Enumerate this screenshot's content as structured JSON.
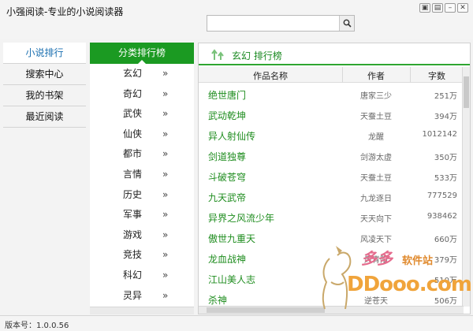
{
  "app": {
    "title": "小强阅读-专业的小说阅读器"
  },
  "search": {
    "value": "",
    "placeholder": ""
  },
  "nav": {
    "items": [
      {
        "label": "小说排行"
      },
      {
        "label": "搜索中心"
      },
      {
        "label": "我的书架"
      },
      {
        "label": "最近阅读"
      }
    ]
  },
  "category": {
    "header": "分类排行榜",
    "items": [
      {
        "label": "玄幻"
      },
      {
        "label": "奇幻"
      },
      {
        "label": "武侠"
      },
      {
        "label": "仙侠"
      },
      {
        "label": "都市"
      },
      {
        "label": "言情"
      },
      {
        "label": "历史"
      },
      {
        "label": "军事"
      },
      {
        "label": "游戏"
      },
      {
        "label": "竞技"
      },
      {
        "label": "科幻"
      },
      {
        "label": "灵异"
      }
    ],
    "arrow": "»"
  },
  "ranking": {
    "title": "玄幻 排行榜",
    "columns": {
      "name": "作品名称",
      "author": "作者",
      "count": "字数"
    },
    "rows": [
      {
        "name": "绝世唐门",
        "author": "唐家三少",
        "count": "251万"
      },
      {
        "name": "武动乾坤",
        "author": "天蚕土豆",
        "count": "394万"
      },
      {
        "name": "异人射仙传",
        "author": "龙醒",
        "count": "1012142"
      },
      {
        "name": "剑道独尊",
        "author": "剑游太虚",
        "count": "350万"
      },
      {
        "name": "斗破苍穹",
        "author": "天蚕土豆",
        "count": "533万"
      },
      {
        "name": "九天武帝",
        "author": "九龙逐日",
        "count": "777529"
      },
      {
        "name": "异界之风流少年",
        "author": "天天向下",
        "count": "938462"
      },
      {
        "name": "傲世九重天",
        "author": "风凌天下",
        "count": "660万"
      },
      {
        "name": "龙血战神",
        "author": "风青阳",
        "count": "379万"
      },
      {
        "name": "江山美人志",
        "author": "",
        "count": "510万"
      },
      {
        "name": "杀神",
        "author": "逆苍天",
        "count": "506万"
      }
    ]
  },
  "status": {
    "version": "版本号：1.0.0.56"
  },
  "watermark": {
    "line1": "多多",
    "line2": "软件站",
    "line3": "DDooo.com"
  },
  "colors": {
    "accent": "#1b9a22",
    "link": "#1f8d1f",
    "nav_active": "#1a6fb0"
  }
}
